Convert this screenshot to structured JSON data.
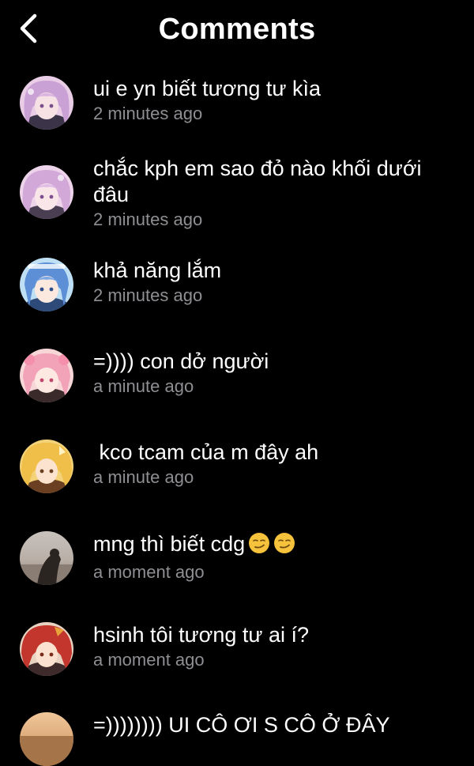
{
  "header": {
    "title": "Comments",
    "back_icon": "chevron-left-icon"
  },
  "comments": [
    {
      "text": "ui e yn biết tương tư kìa",
      "time": "2 minutes ago"
    },
    {
      "text": "chắc kph em sao đỏ nào khối dưới đâu",
      "time": "2 minutes ago"
    },
    {
      "text": "khả năng lắm",
      "time": "2 minutes ago"
    },
    {
      "text": "=)))) con dở người",
      "time": "a minute ago"
    },
    {
      "text": " kco tcam của m đây ah",
      "time": "a minute ago"
    },
    {
      "text": "mng thì biết cdg",
      "time": "a moment ago",
      "emoji": "smirk-emoji"
    },
    {
      "text": "hsinh tôi tương tư ai í?",
      "time": "a moment ago"
    },
    {
      "text": "=)))))))) UI CÔ ƠI S CÔ Ở ĐÂY",
      "time": ""
    }
  ],
  "colors": {
    "background": "#000000",
    "text": "#ffffff",
    "timestamp": "#8e8e93"
  }
}
